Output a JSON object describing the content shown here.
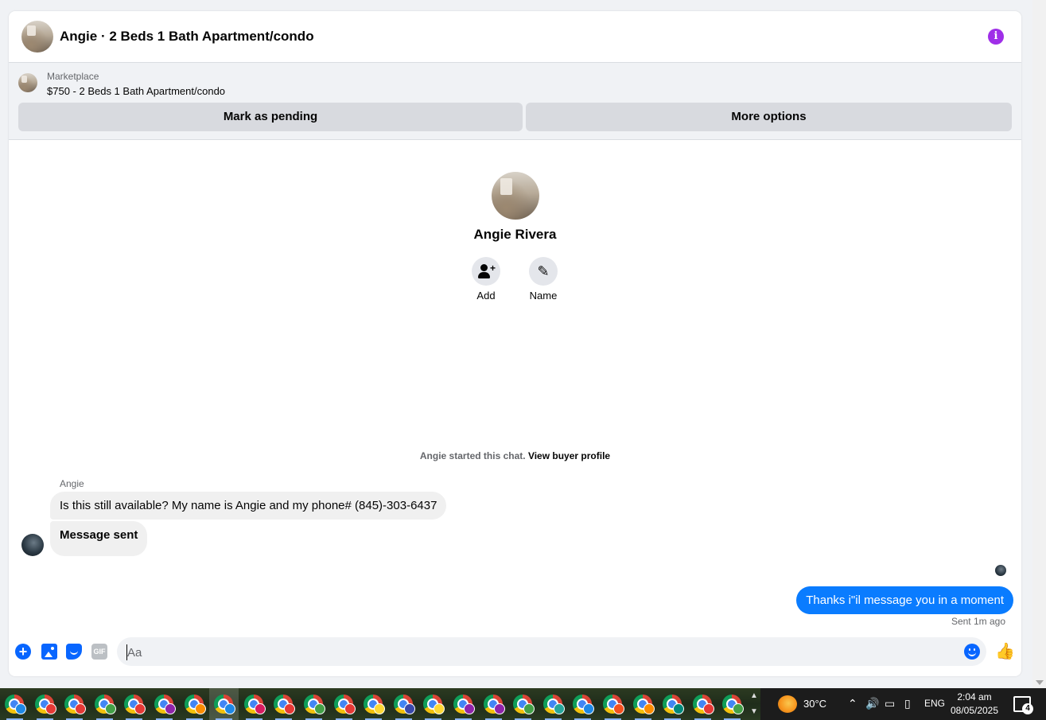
{
  "header": {
    "title": "Angie · 2 Beds 1 Bath Apartment/condo",
    "info_icon": "i"
  },
  "marketplace": {
    "kicker": "Marketplace",
    "listing": "$750 - 2 Beds 1 Bath Apartment/condo",
    "pending_label": "Mark as pending",
    "more_label": "More options"
  },
  "profile": {
    "name": "Angie Rivera",
    "add_label": "Add",
    "name_label": "Name"
  },
  "chat": {
    "started_text": "Angie started this chat.",
    "view_profile": "View buyer profile",
    "sender_name": "Angie",
    "incoming": [
      "Is this still available? My name is Angie  and my phone# (845)-303-6437",
      "Message sent"
    ],
    "outgoing": "Thanks i\"il message you in a moment",
    "sent_status": "Sent 1m ago"
  },
  "composer": {
    "placeholder": "Aa",
    "gif_label": "GIF",
    "plus_glyph": "+",
    "like_glyph": "👍"
  },
  "taskbar": {
    "app_count": 25,
    "badge_colors": [
      "#1e88e5",
      "#e53935",
      "#e53935",
      "#43a047",
      "#e53935",
      "#8e24aa",
      "#fb8c00",
      "#1e88e5",
      "#d81b60",
      "#e53935",
      "#43a047",
      "#e53935",
      "#fdd835",
      "#3949ab",
      "#fdd835",
      "#8e24aa",
      "#8e24aa",
      "#43a047",
      "#26a69a",
      "#1e88e5",
      "#f4511e",
      "#fb8c00",
      "#00897b",
      "#e53935",
      "#43a047"
    ],
    "temperature": "30°C",
    "language": "ENG",
    "time": "2:04 am",
    "date": "08/05/2025",
    "notification_count": "4"
  },
  "colors": {
    "accent_blue": "#0a7cff",
    "info_purple": "#9f2ee8",
    "page_bg": "#f0f2f5"
  }
}
